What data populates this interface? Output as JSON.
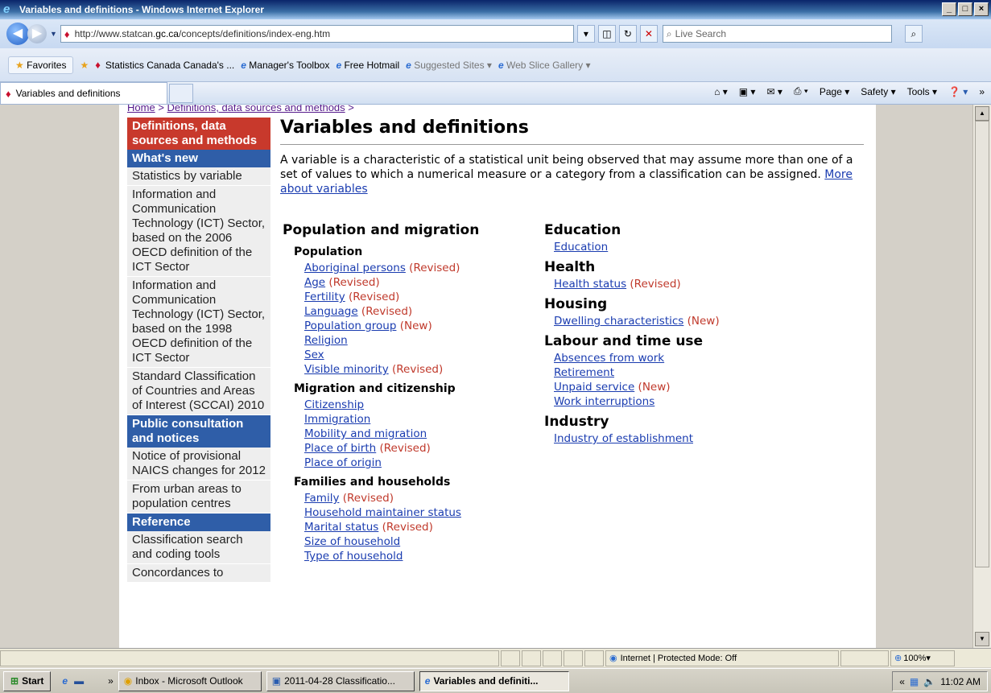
{
  "window": {
    "title": "Variables and definitions - Windows Internet Explorer"
  },
  "address": {
    "url_prefix": "http://www.statcan.",
    "url_domain": "gc.ca",
    "url_suffix": "/concepts/definitions/index-eng.htm",
    "search_placeholder": "Live Search"
  },
  "favorites": {
    "label": "Favorites",
    "items": [
      "Statistics Canada Canada's ...",
      "Manager's Toolbox",
      "Free Hotmail",
      "Suggested Sites ▾",
      "Web Slice Gallery ▾"
    ]
  },
  "tab": {
    "label": "Variables and definitions"
  },
  "commands": {
    "page": "Page ▾",
    "safety": "Safety ▾",
    "tools": "Tools ▾"
  },
  "breadcrumb": {
    "home": "Home",
    "sep": ">",
    "defs": "Definitions, data sources and methods",
    "sep2": ">"
  },
  "leftnav": {
    "header1": "Definitions, data sources and methods",
    "whats_new": "What's new",
    "items1": [
      "Statistics by variable",
      "Information and Communication Technology (ICT) Sector, based on the 2006 OECD definition of the ICT Sector",
      "Information and Communication Technology (ICT) Sector, based on the 1998 OECD definition of the ICT Sector",
      "Standard Classification of Countries and Areas of Interest (SCCAI) 2010"
    ],
    "header2": "Public consultation and notices",
    "items2": [
      "Notice of provisional NAICS changes for 2012",
      "From urban areas to population centres"
    ],
    "header3": "Reference",
    "items3": [
      "Classification search and coding tools",
      "Concordances to"
    ]
  },
  "main": {
    "title": "Variables and definitions",
    "intro": "A variable is a characteristic of a statistical unit being observed that may assume more than one of a set of values to which a numerical measure or a category from a classification can be assigned.",
    "more_link": "More about variables"
  },
  "col1": {
    "section": "Population and migration",
    "population": {
      "label": "Population",
      "links": [
        [
          "Aboriginal persons",
          "(Revised)"
        ],
        [
          "Age",
          "(Revised)"
        ],
        [
          "Fertility",
          "(Revised)"
        ],
        [
          "Language",
          "(Revised)"
        ],
        [
          "Population group",
          "(New)"
        ],
        [
          "Religion",
          ""
        ],
        [
          "Sex",
          ""
        ],
        [
          "Visible minority",
          "(Revised)"
        ]
      ]
    },
    "migration": {
      "label": "Migration and citizenship",
      "links": [
        [
          "Citizenship",
          ""
        ],
        [
          "Immigration",
          ""
        ],
        [
          "Mobility and migration",
          ""
        ],
        [
          "Place of birth",
          "(Revised)"
        ],
        [
          "Place of origin",
          ""
        ]
      ]
    },
    "families": {
      "label": "Families and households",
      "links": [
        [
          "Family",
          "(Revised)"
        ],
        [
          "Household maintainer status",
          ""
        ],
        [
          "Marital status",
          "(Revised)"
        ],
        [
          "Size of household",
          ""
        ],
        [
          "Type of household",
          ""
        ]
      ]
    }
  },
  "col2": {
    "education": {
      "label": "Education",
      "links": [
        [
          "Education",
          ""
        ]
      ]
    },
    "health": {
      "label": "Health",
      "links": [
        [
          "Health status",
          "(Revised)"
        ]
      ]
    },
    "housing": {
      "label": "Housing",
      "links": [
        [
          "Dwelling characteristics",
          "(New)"
        ]
      ]
    },
    "labour": {
      "label": "Labour and time use",
      "links": [
        [
          "Absences from work",
          ""
        ],
        [
          "Retirement",
          ""
        ],
        [
          "Unpaid service",
          "(New)"
        ],
        [
          "Work interruptions",
          ""
        ]
      ]
    },
    "industry": {
      "label": "Industry",
      "links": [
        [
          "Industry of establishment",
          ""
        ]
      ]
    }
  },
  "status": {
    "zone": "Internet | Protected Mode: Off",
    "zoom": "100%"
  },
  "taskbar": {
    "start": "Start",
    "items": [
      "Inbox - Microsoft Outlook",
      "2011-04-28 Classificatio...",
      "Variables and definiti..."
    ],
    "time": "11:02 AM"
  }
}
